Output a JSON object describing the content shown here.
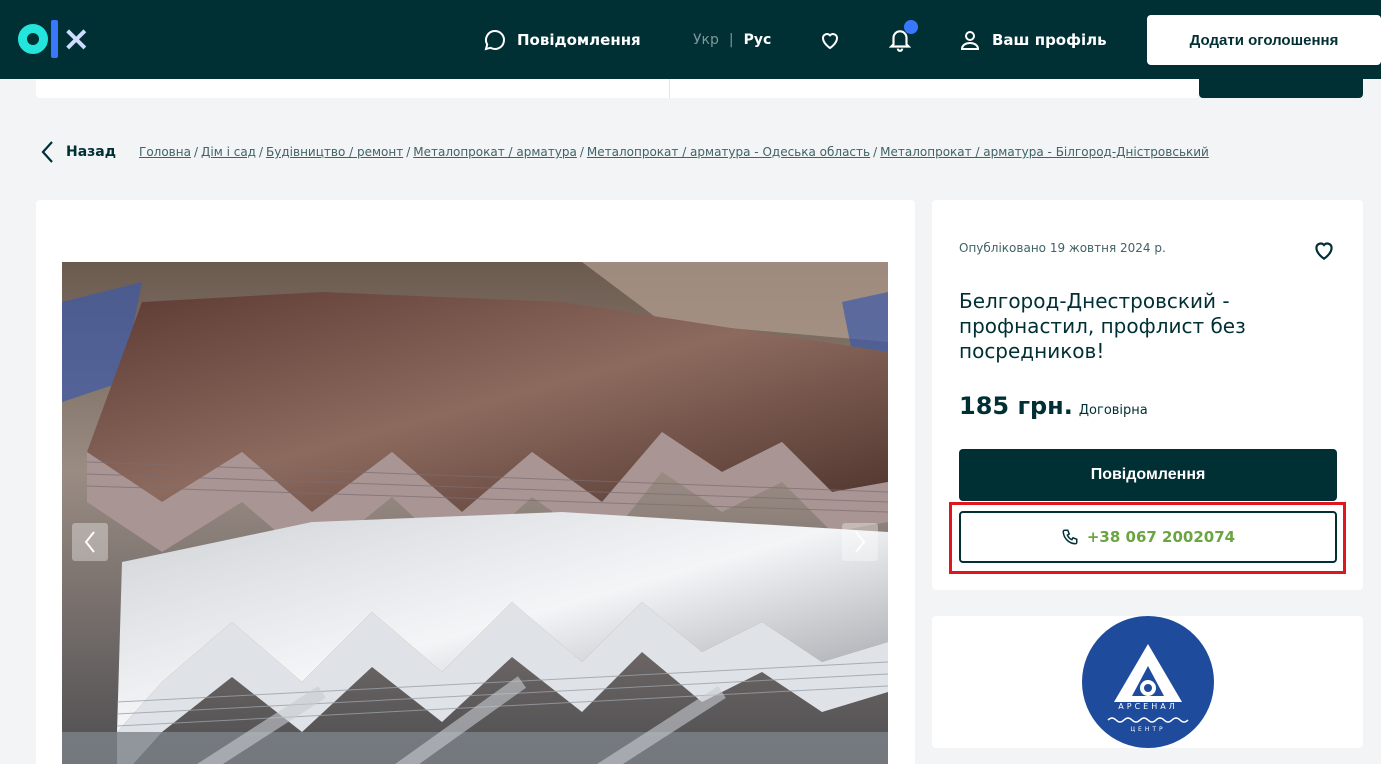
{
  "header": {
    "messages_label": "Повідомлення",
    "lang_ukr": "Укр",
    "lang_sep": "|",
    "lang_rus": "Рус",
    "profile_label": "Ваш профіль",
    "add_ad_label": "Додати оголошення"
  },
  "nav": {
    "back_label": "Назад",
    "breadcrumbs": [
      "Головна",
      "Дім і сад",
      "Будівництво / ремонт",
      "Металопрокат / арматура",
      "Металопрокат / арматура - Одеська область",
      "Металопрокат / арматура - Білгород-Дністровський"
    ],
    "separator": "/"
  },
  "listing": {
    "published": "Опубліковано 19 жовтня 2024 р.",
    "title": "Белгород-Днестровский - профнастил, профлист без посредников!",
    "price": "185 грн.",
    "negotiable": "Договірна",
    "message_button": "Повідомлення",
    "phone": "+38 067 2002074"
  },
  "seller": {
    "logo_text_line1": "АРСЕНАЛ",
    "logo_text_line2": "ЦЕНТР"
  },
  "colors": {
    "brand_dark": "#002f34",
    "brand_teal": "#23e5db",
    "brand_blue": "#3a77ff",
    "phone_green": "#6aa542",
    "highlight_red": "#e0161e",
    "seller_blue": "#1e4b9b"
  },
  "icons": {
    "message": "chat-bubble-icon",
    "favorite": "heart-icon",
    "notification": "bell-icon",
    "profile": "user-icon",
    "back": "chevron-left-icon",
    "phone": "phone-icon",
    "prev": "chevron-left-icon",
    "next": "chevron-right-icon"
  }
}
